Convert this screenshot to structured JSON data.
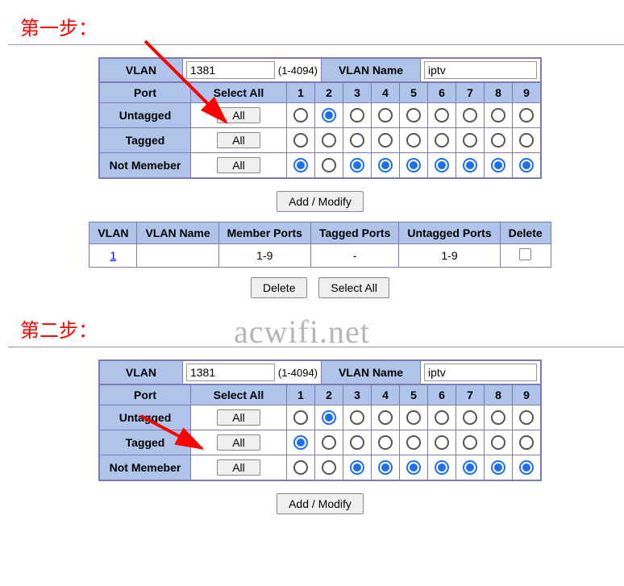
{
  "step1": {
    "label": "第一步：",
    "vlan_label": "VLAN",
    "vlan_value": "1381",
    "range": "(1-4094)",
    "vlanname_label": "VLAN Name",
    "vlanname_value": "iptv",
    "port_header": "Port",
    "selectall_header": "Select All",
    "ports": [
      "1",
      "2",
      "3",
      "4",
      "5",
      "6",
      "7",
      "8",
      "9"
    ],
    "rows": [
      {
        "label": "Untagged",
        "btn": "All",
        "sel": [
          false,
          true,
          false,
          false,
          false,
          false,
          false,
          false,
          false
        ]
      },
      {
        "label": "Tagged",
        "btn": "All",
        "sel": [
          false,
          false,
          false,
          false,
          false,
          false,
          false,
          false,
          false
        ]
      },
      {
        "label": "Not Memeber",
        "btn": "All",
        "sel": [
          true,
          false,
          true,
          true,
          true,
          true,
          true,
          true,
          true
        ]
      }
    ],
    "addmodify": "Add / Modify"
  },
  "list": {
    "headers": [
      "VLAN",
      "VLAN Name",
      "Member Ports",
      "Tagged Ports",
      "Untagged Ports",
      "Delete"
    ],
    "row": {
      "vlan": "1",
      "name": "",
      "member": "1-9",
      "tagged": "-",
      "untagged": "1-9"
    },
    "delete_btn": "Delete",
    "selectall_btn": "Select All"
  },
  "watermark": "acwifi.net",
  "step2": {
    "label": "第二步：",
    "vlan_label": "VLAN",
    "vlan_value": "1381",
    "range": "(1-4094)",
    "vlanname_label": "VLAN Name",
    "vlanname_value": "iptv",
    "port_header": "Port",
    "selectall_header": "Select All",
    "ports": [
      "1",
      "2",
      "3",
      "4",
      "5",
      "6",
      "7",
      "8",
      "9"
    ],
    "rows": [
      {
        "label": "Untagged",
        "btn": "All",
        "sel": [
          false,
          true,
          false,
          false,
          false,
          false,
          false,
          false,
          false
        ]
      },
      {
        "label": "Tagged",
        "btn": "All",
        "sel": [
          true,
          false,
          false,
          false,
          false,
          false,
          false,
          false,
          false
        ]
      },
      {
        "label": "Not Memeber",
        "btn": "All",
        "sel": [
          false,
          false,
          true,
          true,
          true,
          true,
          true,
          true,
          true
        ]
      }
    ],
    "addmodify": "Add / Modify"
  }
}
